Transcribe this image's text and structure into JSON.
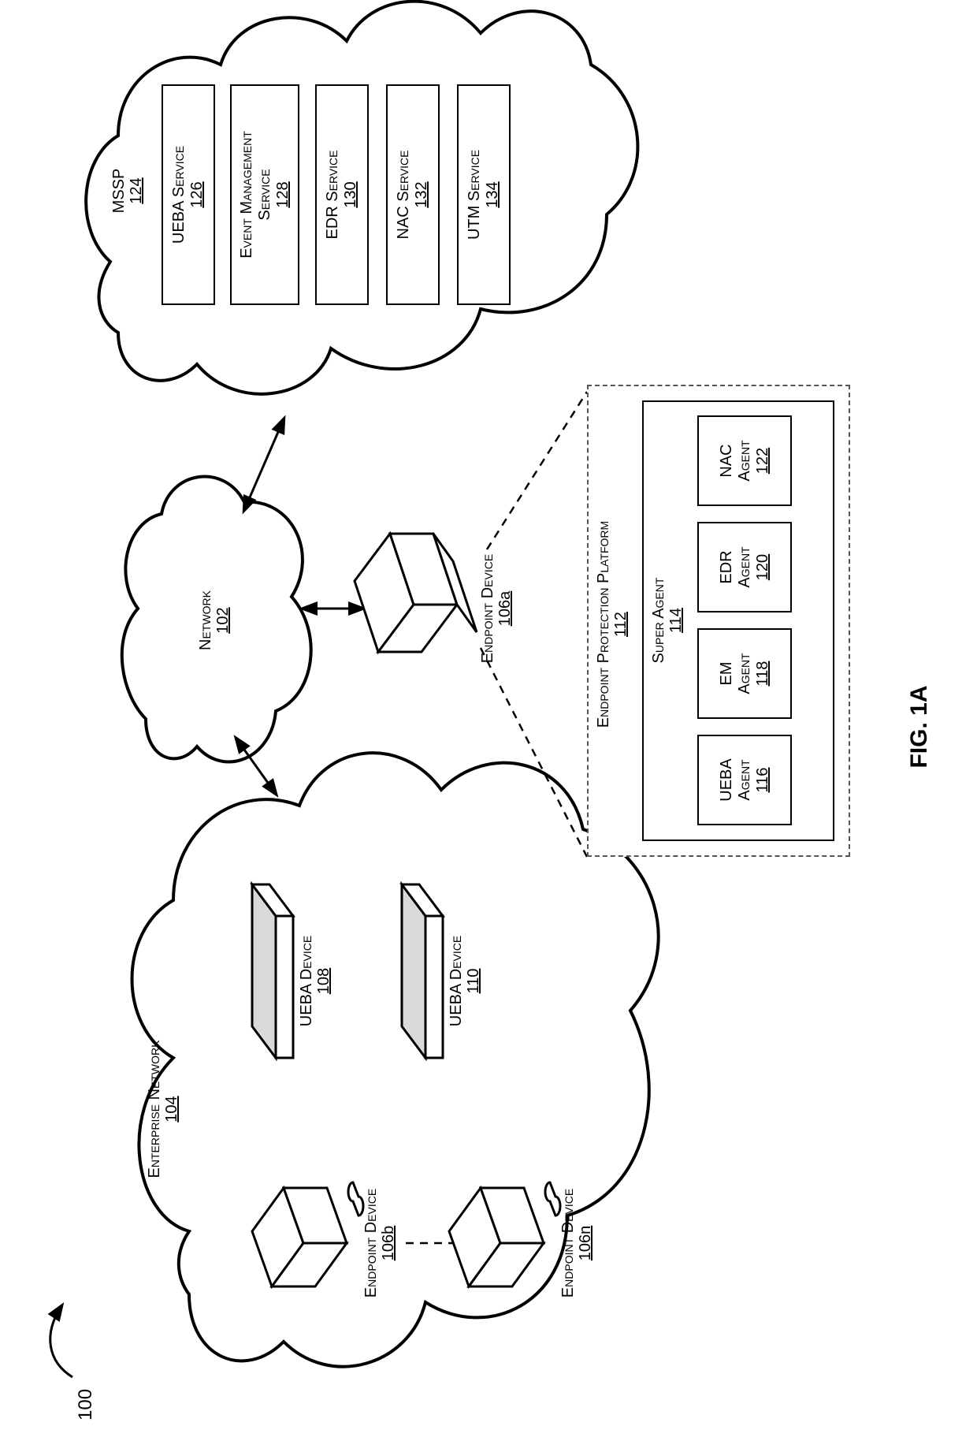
{
  "figure": {
    "ref": "100",
    "caption": "FIG. 1A"
  },
  "network": {
    "name": "Network",
    "num": "102"
  },
  "enterprise_network": {
    "name": "Enterprise Network",
    "num": "104"
  },
  "endpoint_devices": {
    "a": {
      "name": "Endpoint Device",
      "num": "106a"
    },
    "b": {
      "name": "Endpoint Device",
      "num": "106b"
    },
    "n": {
      "name": "Endpoint Device",
      "num": "106n"
    }
  },
  "ueba_devices": {
    "d108": {
      "name": "UEBA Device",
      "num": "108"
    },
    "d110": {
      "name": "UEBA Device",
      "num": "110"
    }
  },
  "epp": {
    "name": "Endpoint Protection Platform",
    "num": "112"
  },
  "super_agent": {
    "name": "Super Agent",
    "num": "114"
  },
  "agents": {
    "ueba": {
      "line1": "UEBA",
      "line2": "Agent",
      "num": "116"
    },
    "em": {
      "line1": "EM",
      "line2": "Agent",
      "num": "118"
    },
    "edr": {
      "line1": "EDR",
      "line2": "Agent",
      "num": "120"
    },
    "nac": {
      "line1": "NAC",
      "line2": "Agent",
      "num": "122"
    }
  },
  "mssp": {
    "name": "MSSP",
    "num": "124"
  },
  "services": {
    "ueba": {
      "name": "UEBA Service",
      "num": "126"
    },
    "event": {
      "line1": "Event Management",
      "line2": "Service",
      "num": "128"
    },
    "edr": {
      "name": "EDR Service",
      "num": "130"
    },
    "nac": {
      "name": "NAC Service",
      "num": "132"
    },
    "utm": {
      "name": "UTM Service",
      "num": "134"
    }
  }
}
